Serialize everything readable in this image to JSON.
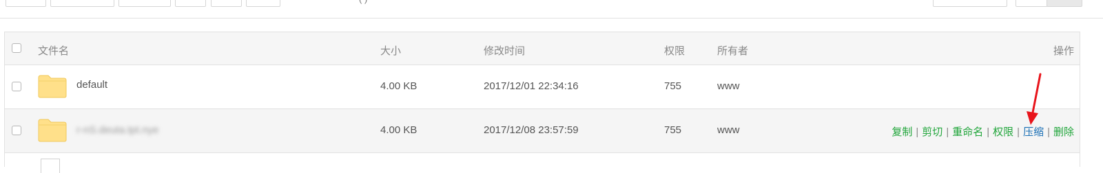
{
  "toolbar": {
    "path_fragment": "( )",
    "buttons": [
      "",
      "",
      "",
      "",
      "",
      ""
    ]
  },
  "table": {
    "headers": {
      "name": "文件名",
      "size": "大小",
      "modified": "修改时间",
      "permission": "权限",
      "owner": "所有者",
      "actions": "操作"
    },
    "rows": [
      {
        "name": "default",
        "size": "4.00 KB",
        "modified": "2017/12/01 22:34:16",
        "permission": "755",
        "owner": "www"
      },
      {
        "name": "r-nS.deuta.tpt.nye",
        "size": "4.00 KB",
        "modified": "2017/12/08 23:57:59",
        "permission": "755",
        "owner": "www"
      }
    ],
    "actions": {
      "copy": "复制",
      "cut": "剪切",
      "rename": "重命名",
      "permission": "权限",
      "compress": "压缩",
      "delete": "删除",
      "separator": "|"
    }
  },
  "colors": {
    "action_green": "#20a53a",
    "action_highlight": "#1a6fb5",
    "annotation_arrow": "#e8141b",
    "folder_yellow": "#ffe08a"
  },
  "icons": [
    "checkbox-icon",
    "folder-icon",
    "file-icon",
    "red-arrow-annotation"
  ]
}
